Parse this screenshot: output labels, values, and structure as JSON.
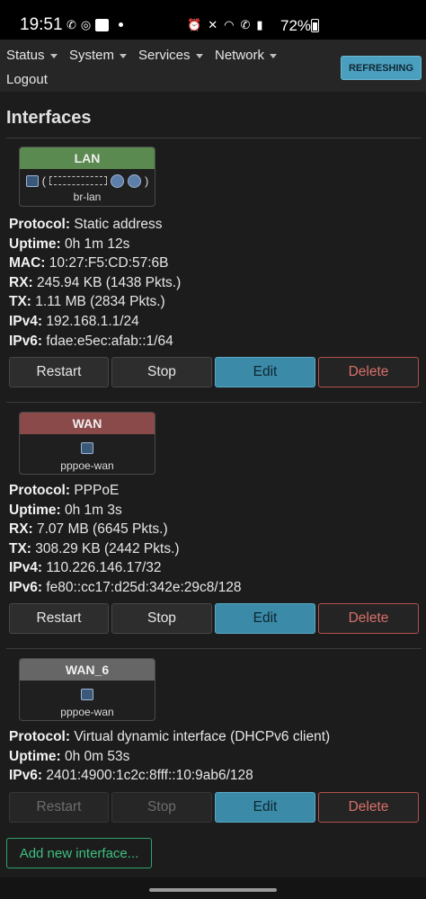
{
  "status_bar": {
    "time": "19:51",
    "battery": "72%",
    "left_icons": [
      "whatsapp-icon",
      "sync-icon",
      "app-icon",
      "notification-dot"
    ],
    "right_icons": [
      "alarm-icon",
      "mute-icon",
      "wifi-icon",
      "wifi-call-icon",
      "signal-icon",
      "battery-icon"
    ]
  },
  "nav": {
    "items": [
      "Status",
      "System",
      "Services",
      "Network"
    ],
    "logout": "Logout",
    "refresh_label": "REFRESHING"
  },
  "page": {
    "title": "Interfaces"
  },
  "interfaces": [
    {
      "name": "LAN",
      "header_color": "#5a8a4f",
      "device": "br-lan",
      "rows": [
        {
          "label": "Protocol:",
          "value": " Static address"
        },
        {
          "label": "Uptime:",
          "value": " 0h 1m 12s"
        },
        {
          "label": "MAC:",
          "value": " 10:27:F5:CD:57:6B"
        },
        {
          "label": "RX:",
          "value": " 245.94 KB (1438 Pkts.)"
        },
        {
          "label": "TX:",
          "value": " 1.11 MB (2834 Pkts.)"
        },
        {
          "label": "IPv4:",
          "value": " 192.168.1.1/24"
        },
        {
          "label": "IPv6:",
          "value": " fdae:e5ec:afab::1/64"
        }
      ],
      "buttons": {
        "restart": "Restart",
        "stop": "Stop",
        "edit": "Edit",
        "delete": "Delete"
      },
      "disabled": false
    },
    {
      "name": "WAN",
      "header_color": "#8b4a4a",
      "device": "pppoe-wan",
      "rows": [
        {
          "label": "Protocol:",
          "value": " PPPoE"
        },
        {
          "label": "Uptime:",
          "value": " 0h 1m 3s"
        },
        {
          "label": "RX:",
          "value": " 7.07 MB (6645 Pkts.)"
        },
        {
          "label": "TX:",
          "value": " 308.29 KB (2442 Pkts.)"
        },
        {
          "label": "IPv4:",
          "value": " 110.226.146.17/32"
        },
        {
          "label": "IPv6:",
          "value": " fe80::cc17:d25d:342e:29c8/128"
        }
      ],
      "buttons": {
        "restart": "Restart",
        "stop": "Stop",
        "edit": "Edit",
        "delete": "Delete"
      },
      "disabled": false
    },
    {
      "name": "WAN_6",
      "header_color": "#666666",
      "device": "pppoe-wan",
      "rows": [
        {
          "label": "Protocol:",
          "value": " Virtual dynamic interface (DHCPv6 client)"
        },
        {
          "label": "Uptime:",
          "value": " 0h 0m 53s"
        },
        {
          "label": "IPv6:",
          "value": " 2401:4900:1c2c:8fff::10:9ab6/128"
        }
      ],
      "buttons": {
        "restart": "Restart",
        "stop": "Stop",
        "edit": "Edit",
        "delete": "Delete"
      },
      "disabled": true
    }
  ],
  "actions": {
    "add_interface": "Add new interface..."
  }
}
